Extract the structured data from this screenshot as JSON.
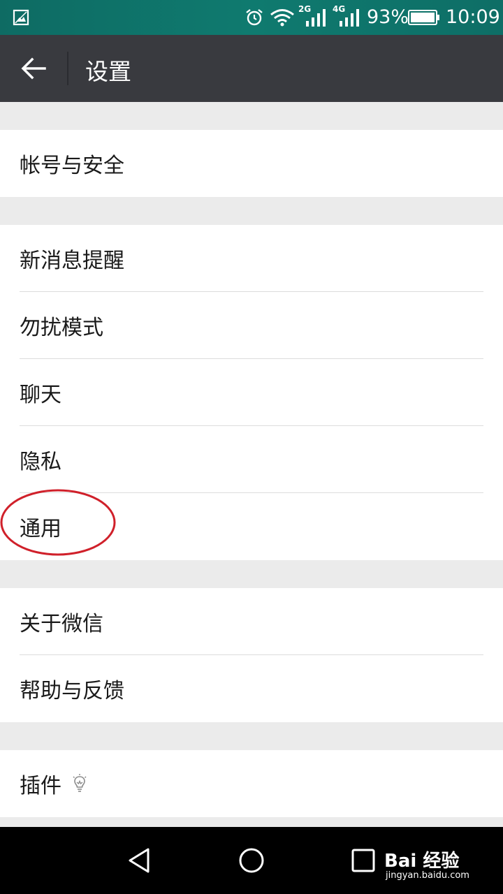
{
  "status_bar": {
    "network_2g": "2G",
    "network_4g": "4G",
    "battery_percent": "93%",
    "time": "10:09",
    "icons": [
      "gallery-icon",
      "alarm-icon",
      "wifi-icon",
      "signal-icon",
      "battery-icon"
    ]
  },
  "toolbar": {
    "back_icon": "arrow-left-icon",
    "title": "设置"
  },
  "settings": {
    "group1": [
      {
        "label": "帐号与安全"
      }
    ],
    "group2": [
      {
        "label": "新消息提醒"
      },
      {
        "label": "勿扰模式"
      },
      {
        "label": "聊天"
      },
      {
        "label": "隐私"
      },
      {
        "label": "通用"
      }
    ],
    "group3": [
      {
        "label": "关于微信"
      },
      {
        "label": "帮助与反馈"
      }
    ],
    "group4": [
      {
        "label": "插件",
        "icon": "lightbulb-icon"
      }
    ]
  },
  "annotation": {
    "highlight_color": "#d0202a"
  },
  "nav_bar": {
    "icons": [
      "nav-back-icon",
      "nav-home-icon",
      "nav-recent-icon"
    ]
  },
  "watermark": {
    "brand": "Bai 经验",
    "url": "jingyan.baidu.com"
  },
  "colors": {
    "status_bar": "#0f7a6f",
    "toolbar": "#393a3f",
    "background": "#ebebeb"
  }
}
